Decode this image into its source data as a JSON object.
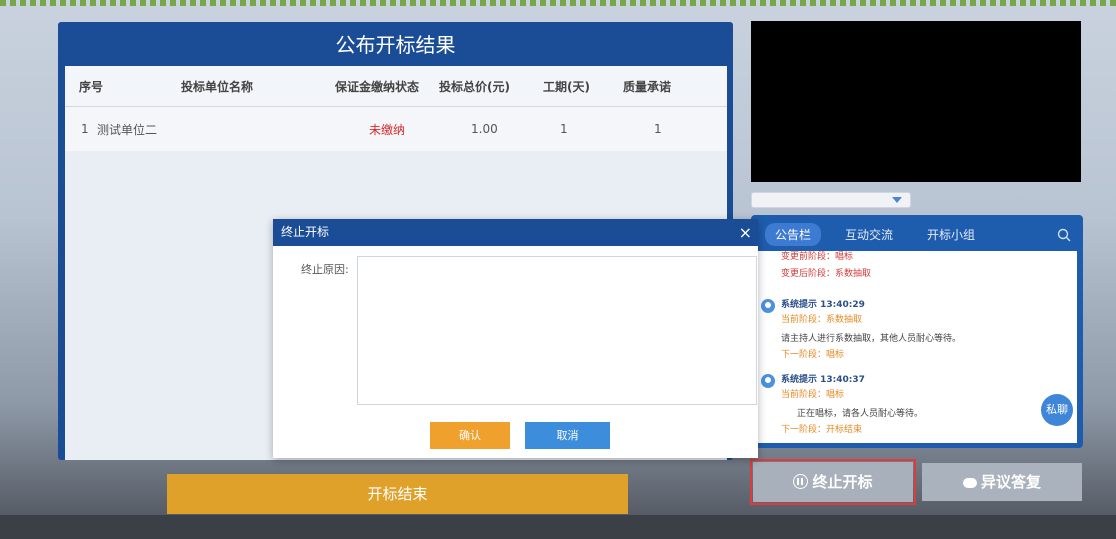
{
  "result": {
    "title": "公布开标结果",
    "headers": [
      "序号",
      "投标单位名称",
      "保证金缴纳状态",
      "投标总价(元)",
      "工期(天)",
      "质量承诺"
    ],
    "rows": [
      {
        "no": "1",
        "name": "测试单位二",
        "deposit": "未缴纳",
        "price": "1.00",
        "days": "1",
        "quality": "1"
      }
    ]
  },
  "chat": {
    "tabs": [
      "公告栏",
      "互动交流",
      "开标小组"
    ],
    "top_lines": [
      "变更前阶段：唱标",
      "变更后阶段：系数抽取"
    ],
    "messages": [
      {
        "head": "系统提示 13:40:29",
        "current": "当前阶段：系数抽取",
        "text": "请主持人进行系数抽取，其他人员耐心等待。",
        "next": "下一阶段：唱标"
      },
      {
        "head": "系统提示 13:40:37",
        "current": "当前阶段：唱标",
        "text": "正在唱标，请各人员耐心等待。",
        "next": "下一阶段：开标结束"
      }
    ],
    "private_label": "私聊"
  },
  "buttons": {
    "end": "开标结束",
    "stop": "终止开标",
    "objection": "异议答复"
  },
  "modal": {
    "title": "终止开标",
    "close": "×",
    "reason_label": "终止原因:",
    "ok": "确认",
    "cancel": "取消"
  }
}
